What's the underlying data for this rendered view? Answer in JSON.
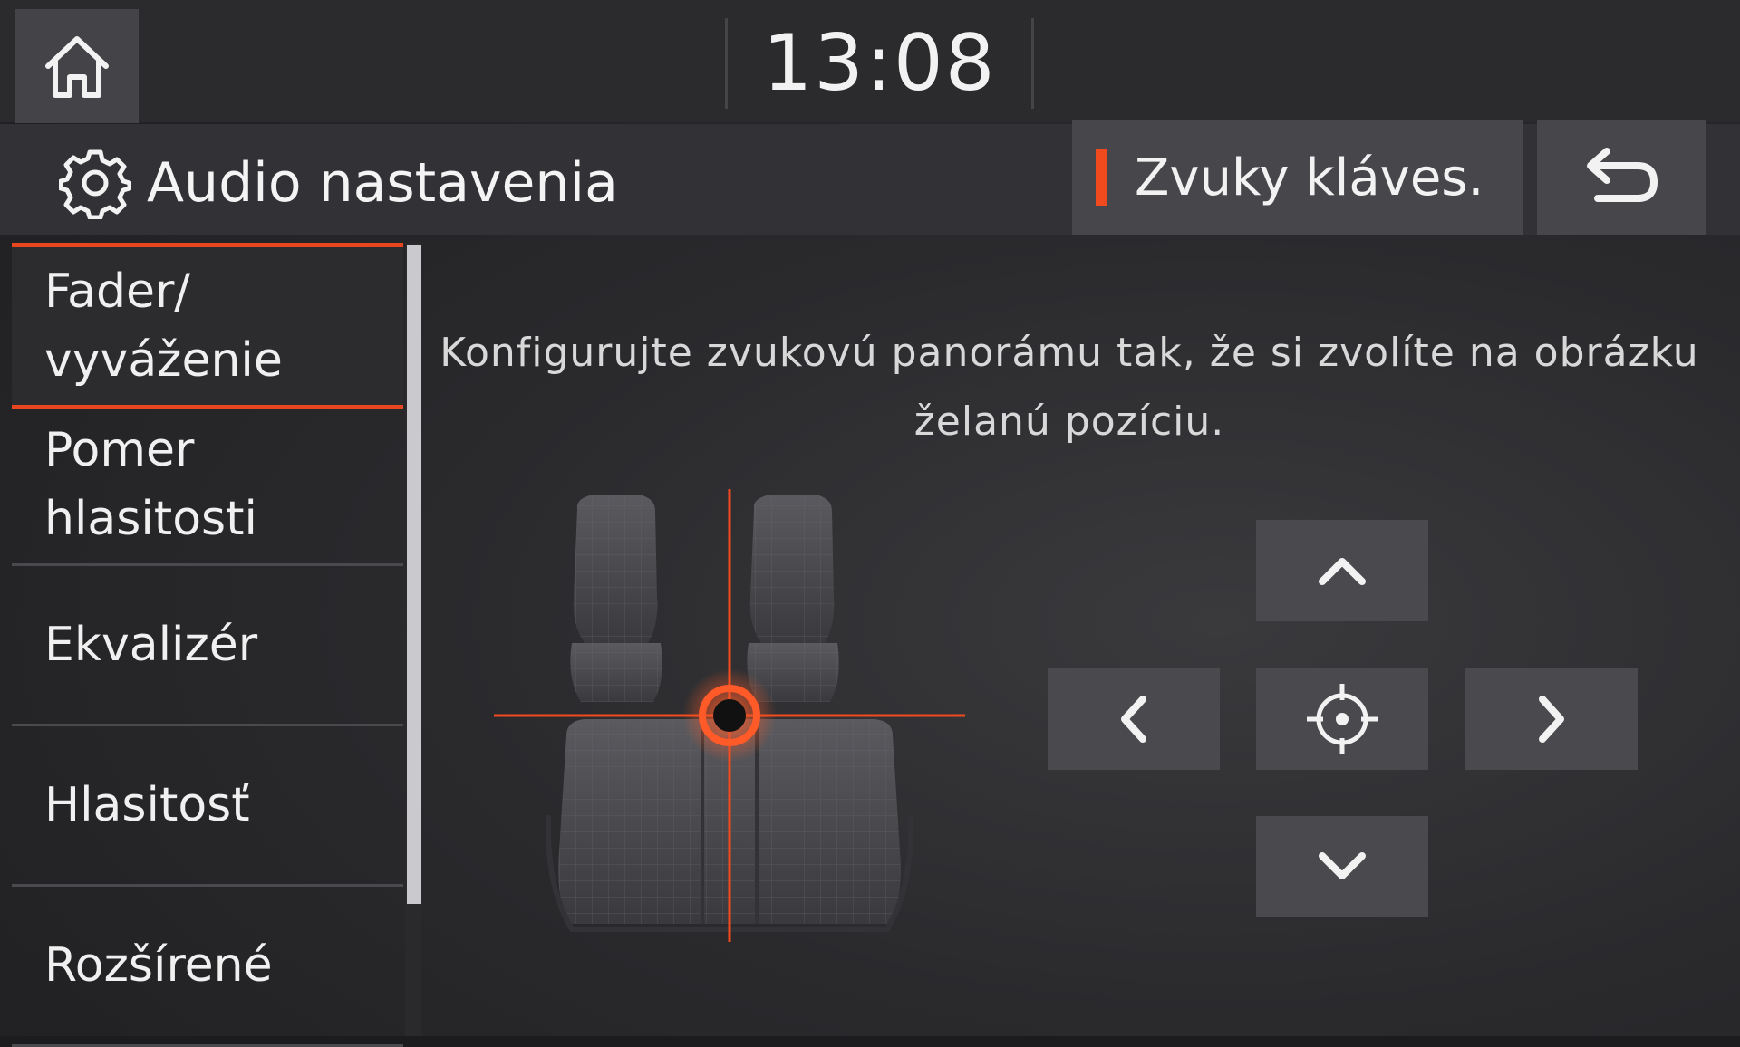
{
  "status_bar": {
    "home_icon": "home-icon",
    "time": "13:08"
  },
  "header": {
    "settings_icon": "gear-icon",
    "title": "Audio nastavenia",
    "key_sounds_label": "Zvuky kláves.",
    "key_sounds_indicator_color": "#f04a1e",
    "back_icon": "back-arrow-icon"
  },
  "sidebar": {
    "items": [
      {
        "label": "Fader/\nvyváženie",
        "active": true
      },
      {
        "label": "Pomer\nhlasitosti",
        "active": false
      },
      {
        "label": "Ekvalizér",
        "active": false
      },
      {
        "label": "Hlasitosť",
        "active": false
      },
      {
        "label": "Rozšírené",
        "active": false
      }
    ]
  },
  "main": {
    "instruction": "Konfigurujte zvukovú panorámu tak, že si zvolíte na obrázku želanú pozíciu.",
    "seat_diagram_icon": "car-seats-icon",
    "position_marker_color": "#f04a1e",
    "fader_position": {
      "front_back": 0,
      "left_right": 0
    },
    "controls": {
      "up_icon": "chevron-up-icon",
      "down_icon": "chevron-down-icon",
      "left_icon": "chevron-left-icon",
      "right_icon": "chevron-right-icon",
      "center_icon": "crosshair-center-icon"
    }
  },
  "colors": {
    "accent": "#e8461e",
    "background": "#1e1e20",
    "button": "#4a4a4e"
  }
}
